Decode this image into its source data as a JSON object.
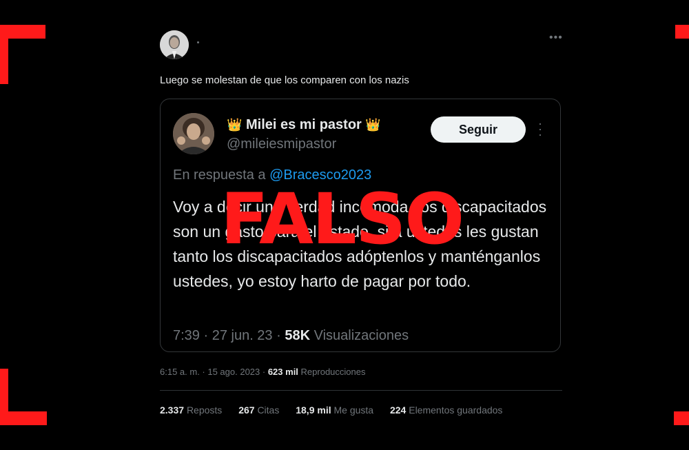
{
  "colors": {
    "accent": "#1d9bf0",
    "stamp": "#ff1a1a",
    "background": "#000000"
  },
  "tweet": {
    "more_icon": "more-horizontal-icon",
    "text": "Luego se molestan de que los comparen con los nazis",
    "time": "6:15 a. m. · 15 ago. 2023 · ",
    "views_count": "623 mil",
    "views_label": "Reproducciones",
    "stats": [
      {
        "count": "2.337",
        "label": "Reposts"
      },
      {
        "count": "267",
        "label": "Citas"
      },
      {
        "count": "18,9 mil",
        "label": "Me gusta"
      },
      {
        "count": "224",
        "label": "Elementos guardados"
      }
    ]
  },
  "quoted": {
    "crown_left": "👑",
    "crown_right": "👑",
    "display_name": "Milei es mi pastor",
    "handle": "@mileiesmipastor",
    "follow_label": "Seguir",
    "reply_prefix": "En respuesta a ",
    "reply_handle": "@Bracesco2023",
    "body": "Voy a decir una verdad incómoda, los discapacitados son un gasto para el estado, si a ustedes les gustan tanto los discapacitados adóptenlos y manténganlos ustedes, yo estoy harto de pagar por todo.",
    "time": "7:39 · 27 jun. 23 · ",
    "views_count": "58K",
    "views_label": "Visualizaciones"
  },
  "stamp": {
    "label": "FALSO"
  }
}
